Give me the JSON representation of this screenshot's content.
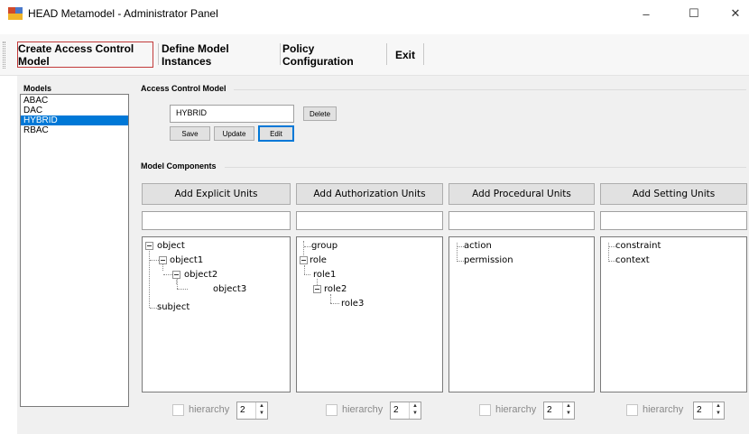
{
  "window": {
    "title": "HEAD Metamodel - Administrator Panel",
    "minimize_glyph": "–",
    "maximize_glyph": "☐",
    "close_glyph": "✕"
  },
  "toolbar": {
    "items": [
      {
        "label": "Create Access Control Model",
        "active": true
      },
      {
        "label": "Define Model Instances",
        "active": false
      },
      {
        "label": "Policy Configuration",
        "active": false
      },
      {
        "label": "Exit",
        "active": false
      }
    ]
  },
  "models": {
    "label": "Models",
    "items": [
      "ABAC",
      "DAC",
      "HYBRID",
      "RBAC"
    ],
    "selected": "HYBRID"
  },
  "access_control_model": {
    "label": "Access Control Model",
    "value": "HYBRID",
    "delete_label": "Delete",
    "save_label": "Save",
    "update_label": "Update",
    "edit_label": "Edit"
  },
  "model_components": {
    "label": "Model Components",
    "columns": [
      {
        "button": "Add Explicit Units",
        "input_value": "",
        "tree": [
          "object",
          "object1",
          "object2",
          "object3",
          "subject"
        ],
        "hierarchy_label": "hierarchy",
        "hierarchy_value": "2",
        "hierarchy_checked": false
      },
      {
        "button": "Add Authorization Units",
        "input_value": "",
        "tree": [
          "group",
          "role",
          "role1",
          "role2",
          "role3"
        ],
        "hierarchy_label": "hierarchy",
        "hierarchy_value": "2",
        "hierarchy_checked": false
      },
      {
        "button": "Add Procedural Units",
        "input_value": "",
        "tree": [
          "action",
          "permission"
        ],
        "hierarchy_label": "hierarchy",
        "hierarchy_value": "2",
        "hierarchy_checked": false
      },
      {
        "button": "Add Setting Units",
        "input_value": "",
        "tree": [
          "constraint",
          "context"
        ],
        "hierarchy_label": "hierarchy",
        "hierarchy_value": "2",
        "hierarchy_checked": false
      }
    ]
  },
  "colors": {
    "selection": "#0078d7",
    "active_tab_border": "#c23a3a"
  }
}
